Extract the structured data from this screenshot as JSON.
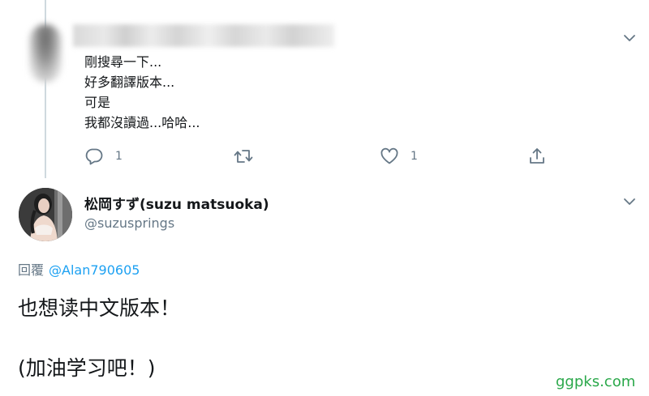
{
  "reply_tweet": {
    "lines": [
      "剛搜尋一下...",
      "好多翻譯版本...",
      "可是",
      "我都沒讀過...哈哈..."
    ],
    "actions": {
      "reply_count": "1",
      "retweet_count": "",
      "like_count": "1"
    },
    "icons": [
      "reply-icon",
      "retweet-icon",
      "like-icon",
      "share-icon",
      "chevron-down-icon"
    ]
  },
  "main_tweet": {
    "display_name": "松岡すず(suzu matsuoka)",
    "handle": "@suzusprings",
    "replying_prefix": "回覆",
    "replying_to": "@Alan790605",
    "body_line1": "也想读中文版本！",
    "body_line2": "(加油学习吧！)"
  },
  "watermark": "ggpks.com",
  "colors": {
    "text": "#14171a",
    "secondary": "#657786",
    "link": "#1da1f2",
    "thread_line": "#cfd9de",
    "watermark": "#2aa84a"
  }
}
